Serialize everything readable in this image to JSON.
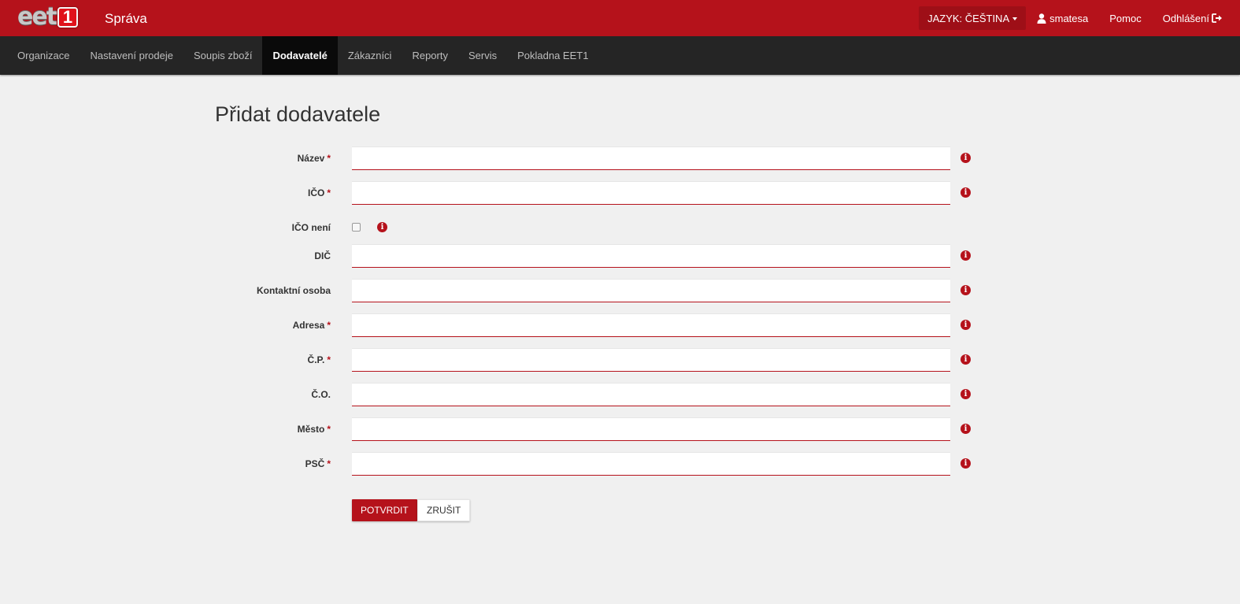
{
  "header": {
    "logo_text": "eet",
    "logo_badge": "1",
    "title": "Správa",
    "language_label": "JAZYK: ČEŠTINA",
    "user_icon": "user-icon",
    "username": "smatesa",
    "help_label": "Pomoc",
    "logout_label": "Odhlášení",
    "logout_icon": "sign-out-icon"
  },
  "nav": {
    "items": [
      {
        "label": "Organizace",
        "active": false
      },
      {
        "label": "Nastavení prodeje",
        "active": false
      },
      {
        "label": "Soupis zboží",
        "active": false
      },
      {
        "label": "Dodavatelé",
        "active": true
      },
      {
        "label": "Zákazníci",
        "active": false
      },
      {
        "label": "Reporty",
        "active": false
      },
      {
        "label": "Servis",
        "active": false
      },
      {
        "label": "Pokladna EET1",
        "active": false
      }
    ]
  },
  "page": {
    "title": "Přidat dodavatele"
  },
  "form": {
    "required_marker": "*",
    "fields": [
      {
        "label": "Název",
        "required": true,
        "value": ""
      },
      {
        "label": "IČO",
        "required": true,
        "value": ""
      },
      {
        "label": "IČO není",
        "type": "checkbox",
        "checked": false
      },
      {
        "label": "DIČ",
        "required": false,
        "value": ""
      },
      {
        "label": "Kontaktní osoba",
        "required": false,
        "value": ""
      },
      {
        "label": "Adresa",
        "required": true,
        "value": ""
      },
      {
        "label": "Č.P.",
        "required": true,
        "value": ""
      },
      {
        "label": "Č.O.",
        "required": false,
        "value": ""
      },
      {
        "label": "Město",
        "required": true,
        "value": ""
      },
      {
        "label": "PSČ",
        "required": true,
        "value": ""
      }
    ],
    "info_icon": "info-icon",
    "submit_label": "POTVRDIT",
    "cancel_label": "ZRUŠIT"
  },
  "colors": {
    "brand": "#b5121b",
    "nav_bg": "#252525",
    "page_bg": "#f0f0f0"
  }
}
